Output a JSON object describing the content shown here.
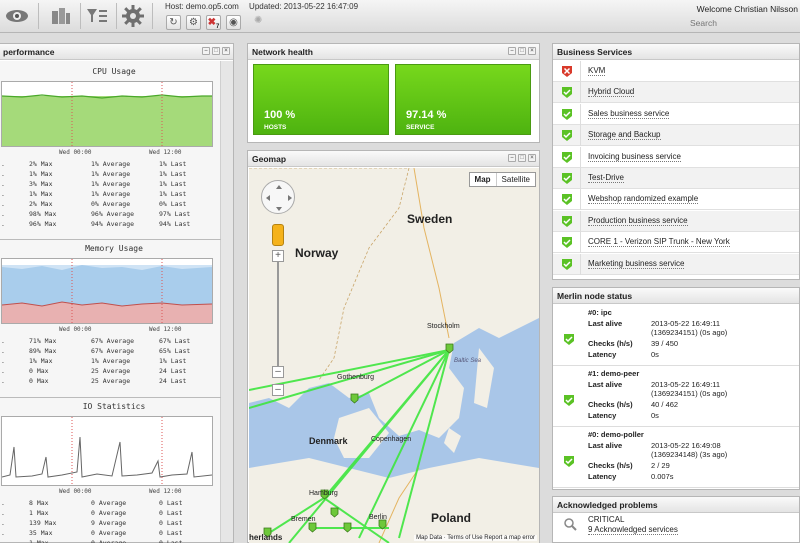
{
  "topbar": {
    "icons": [
      "eye-icon",
      "dashboard-icon",
      "filter-list-icon",
      "gear-icon"
    ],
    "host_text": "Host: demo.op5.com",
    "updated_text": "Updated: 2013-05-22 16:47:09",
    "alert_badge": "7",
    "welcome": "Welcome Christian Nilsson",
    "search_placeholder": "Search"
  },
  "performance": {
    "title": "performance",
    "side_label": "CPU Usage",
    "cpu": {
      "title": "CPU Usage",
      "x_labels": [
        "Wed 00:00",
        "Wed 12:00"
      ],
      "rows": [
        {
          "max": "2% Max",
          "avg": "1% Average",
          "last": "1% Last"
        },
        {
          "max": "1% Max",
          "avg": "1% Average",
          "last": "1% Last"
        },
        {
          "max": "3% Max",
          "avg": "1% Average",
          "last": "1% Last"
        },
        {
          "max": "1% Max",
          "avg": "1% Average",
          "last": "1% Last"
        },
        {
          "max": "2% Max",
          "avg": "0% Average",
          "last": "0% Last"
        },
        {
          "max": "98% Max",
          "avg": "96% Average",
          "last": "97% Last"
        },
        {
          "max": "96% Max",
          "avg": "94% Average",
          "last": "94% Last"
        }
      ]
    },
    "memory": {
      "title": "Memory Usage",
      "x_labels": [
        "Wed 00:00",
        "Wed 12:00"
      ],
      "rows": [
        {
          "max": "71% Max",
          "avg": "67% Average",
          "last": "67% Last"
        },
        {
          "max": "89% Max",
          "avg": "67% Average",
          "last": "65% Last"
        },
        {
          "max": "1% Max",
          "avg": "1% Average",
          "last": "1% Last"
        },
        {
          "max": "0 Max",
          "avg": "25 Average",
          "last": "24 Last"
        },
        {
          "max": "0 Max",
          "avg": "25 Average",
          "last": "24 Last"
        }
      ]
    },
    "io": {
      "title": "IO Statistics",
      "x_labels": [
        "Wed 00:00",
        "Wed 12:00"
      ],
      "rows": [
        {
          "max": "8 Max",
          "avg": "0 Average",
          "last": "0 Last"
        },
        {
          "max": "1 Max",
          "avg": "0 Average",
          "last": "0 Last"
        },
        {
          "max": "139 Max",
          "avg": "9 Average",
          "last": "0 Last"
        },
        {
          "max": "35 Max",
          "avg": "0 Average",
          "last": "0 Last"
        },
        {
          "max": "1 Max",
          "avg": "0 Average",
          "last": "0 Last"
        }
      ]
    }
  },
  "network_health": {
    "title": "Network health",
    "tiles": [
      {
        "value": "100 %",
        "label": "HOSTS"
      },
      {
        "value": "97.14 %",
        "label": "SERVICE"
      }
    ]
  },
  "geomap": {
    "title": "Geomap",
    "map_button": "Map",
    "satellite_button": "Satellite",
    "labels": {
      "sweden": "Sweden",
      "norway": "Norway",
      "denmark": "Denmark",
      "poland": "Poland",
      "stockholm": "Stockholm",
      "gothenburg": "Gothenburg",
      "copenhagen": "Copenhagen",
      "hamburg": "Hamburg",
      "berlin": "Berlin",
      "bremen": "Bremen",
      "baltic": "Baltic Sea",
      "netherlands": "herlands"
    },
    "footer": "Map Data · Terms of Use   Report a map error"
  },
  "business_services": {
    "title": "Business Services",
    "items": [
      {
        "label": "KVM",
        "status": "critical"
      },
      {
        "label": "Hybrid Cloud",
        "status": "ok"
      },
      {
        "label": "Sales business service",
        "status": "ok"
      },
      {
        "label": "Storage and Backup",
        "status": "ok"
      },
      {
        "label": "Invoicing business service",
        "status": "ok"
      },
      {
        "label": "Test-Drive",
        "status": "ok"
      },
      {
        "label": "Webshop randomized example",
        "status": "ok"
      },
      {
        "label": "Production business service",
        "status": "ok"
      },
      {
        "label": "CORE 1 - Verizon SIP Trunk - New York",
        "status": "ok"
      },
      {
        "label": "Marketing business service",
        "status": "ok"
      }
    ]
  },
  "merlin": {
    "title": "Merlin node status",
    "labels": {
      "last_alive": "Last alive",
      "checks": "Checks (h/s)",
      "latency": "Latency"
    },
    "nodes": [
      {
        "name": "#0: ipc",
        "last_alive_1": "2013-05-22 16:49:11",
        "last_alive_2": "(1369234151) (0s ago)",
        "checks": "39 / 450",
        "latency": "0s"
      },
      {
        "name": "#1: demo-peer",
        "last_alive_1": "2013-05-22 16:49:11",
        "last_alive_2": "(1369234151) (0s ago)",
        "checks": "40 / 462",
        "latency": "0s"
      },
      {
        "name": "#0: demo-poller",
        "last_alive_1": "2013-05-22 16:49:08",
        "last_alive_2": "(1369234148) (3s ago)",
        "checks": "2 / 29",
        "latency": "0.007s"
      }
    ]
  },
  "acknowledged": {
    "title": "Acknowledged problems",
    "line1": "CRITICAL",
    "line2": "9 Acknowledged services"
  },
  "colors": {
    "ok_green": "#5bc225",
    "critical_red": "#d93a2b",
    "map_water": "#a9c6e8",
    "map_land": "#f2efe6",
    "link_green": "#3ee63e"
  }
}
